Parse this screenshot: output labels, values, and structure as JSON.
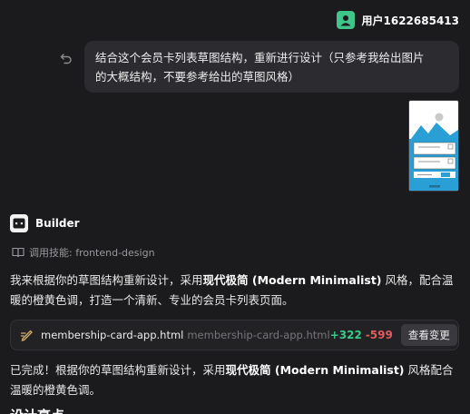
{
  "user": {
    "name": "用户1622685413"
  },
  "message": {
    "line1": "结合这个会员卡列表草图结构，重新进行设计（只参考我给出图片",
    "line2": "的大概结构，不要参考给出的草图风格）"
  },
  "assistant": {
    "name": "Builder",
    "skill": "调用技能: frontend-design",
    "para1": {
      "pre": "我来根据你的草图结构重新设计，采用",
      "bold": "现代极简 (Modern Minimalist)",
      "post": " 风格，配合温",
      "line2": "暖的橙黄色调，打造一个清新、专业的会员卡列表页面。"
    },
    "file": {
      "name": "membership-card-app.html",
      "path": "membership-card-app.html",
      "added": "+322",
      "removed": "-599",
      "button": "查看变更"
    },
    "para2": {
      "pre": "已完成！根据你的草图结构重新设计，采用",
      "bold": "现代极简 (Modern Minimalist)",
      "post": " 风格配合",
      "line2": "温暖的橙黄色调。"
    },
    "next_heading": "设计亮点"
  },
  "colors": {
    "background": "#1b1b1d",
    "bubble": "#2c2c30",
    "avatar": "#3fc58a",
    "added": "#38c98a",
    "removed": "#e85a5a",
    "sketch_blue": "#2a9fd6"
  }
}
